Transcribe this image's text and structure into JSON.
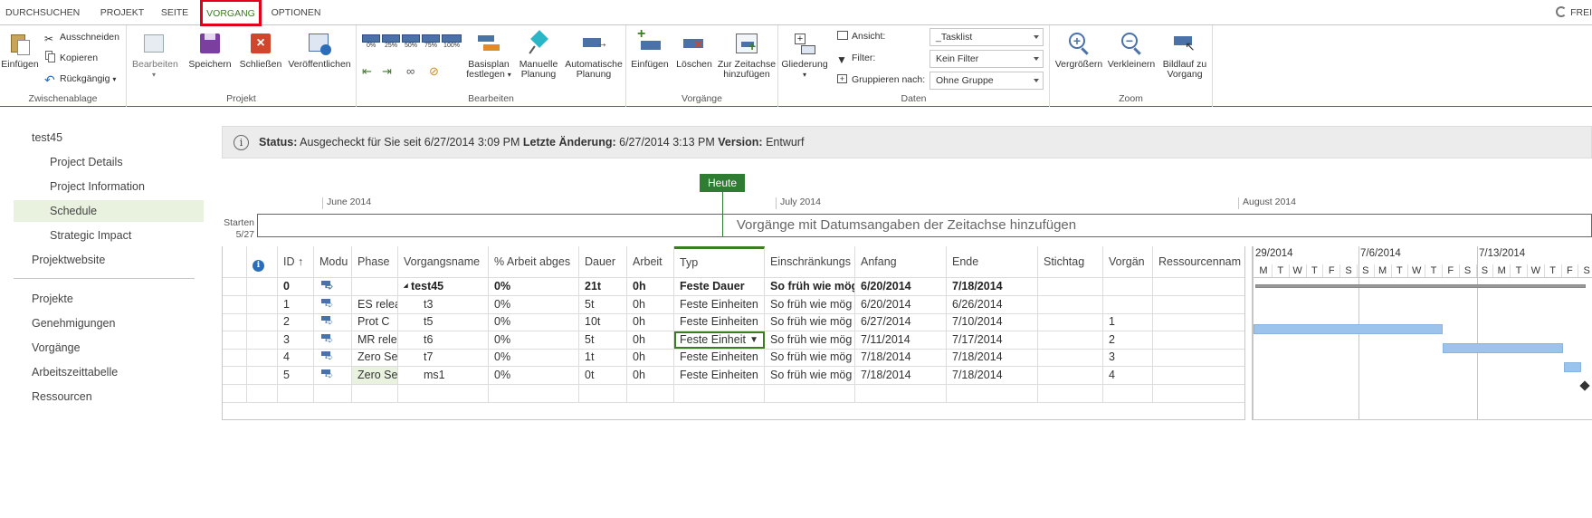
{
  "tabs": [
    "DURCHSUCHEN",
    "PROJEKT",
    "SEITE",
    "VORGANG",
    "OPTIONEN"
  ],
  "active_tab": "VORGANG",
  "share_label": "FREI",
  "ribbon": {
    "zwischenablage": {
      "label": "Zwischenablage",
      "einfuegen": "Einfügen",
      "ausschneiden": "Ausschneiden",
      "kopieren": "Kopieren",
      "rueckgaengig": "Rückgängig"
    },
    "projekt": {
      "label": "Projekt",
      "bearbeiten": "Bearbeiten",
      "speichern": "Speichern",
      "schliessen": "Schließen",
      "veroeffentlichen": "Veröffentlichen"
    },
    "bearbeiten": {
      "label": "Bearbeiten",
      "pct": [
        "0%",
        "25%",
        "50%",
        "75%",
        "100%"
      ],
      "basisplan_1": "Basisplan",
      "basisplan_2": "festlegen",
      "manuelle_1": "Manuelle",
      "manuelle_2": "Planung",
      "automatische_1": "Automatische",
      "automatische_2": "Planung"
    },
    "vorgaenge": {
      "label": "Vorgänge",
      "einfuegen": "Einfügen",
      "loeschen": "Löschen",
      "zeitachse_1": "Zur Zeitachse",
      "zeitachse_2": "hinzufügen"
    },
    "daten": {
      "label": "Daten",
      "gliederung": "Gliederung",
      "ansicht": "Ansicht:",
      "ansicht_value": "_Tasklist",
      "filter": "Filter:",
      "filter_value": "Kein Filter",
      "gruppieren": "Gruppieren nach:",
      "gruppieren_value": "Ohne Gruppe"
    },
    "zoom": {
      "label": "Zoom",
      "vergroessern": "Vergrößern",
      "verkleinern": "Verkleinern",
      "bildlauf_1": "Bildlauf zu",
      "bildlauf_2": "Vorgang"
    }
  },
  "nav": {
    "items": [
      "test45",
      "Project Details",
      "Project Information",
      "Schedule",
      "Strategic Impact",
      "Projektwebsite"
    ],
    "items2": [
      "Projekte",
      "Genehmigungen",
      "Vorgänge",
      "Arbeitszeittabelle",
      "Ressourcen"
    ],
    "selected": "Schedule"
  },
  "status": {
    "label_status": "Status:",
    "status_text": "Ausgecheckt für Sie seit 6/27/2014 3:09 PM",
    "label_last": "Letzte Änderung:",
    "last_text": "6/27/2014 3:13 PM",
    "label_version": "Version:",
    "version_text": "Entwurf"
  },
  "timeline": {
    "today_label": "Heute",
    "months": [
      "June 2014",
      "July 2014",
      "August 2014"
    ],
    "start_label_1": "Starten",
    "start_label_2": "5/27",
    "placeholder": "Vorgänge mit Datumsangaben der Zeitachse hinzufügen"
  },
  "grid": {
    "headers": [
      "ID ↑",
      "Modu",
      "Phase",
      "Vorgangsname",
      "% Arbeit abges",
      "Dauer",
      "Arbeit",
      "Typ",
      "Einschränkungs",
      "Anfang",
      "Ende",
      "Stichtag",
      "Vorgän",
      "Ressourcennam"
    ],
    "rows": [
      {
        "id": "0",
        "phase": "",
        "name": "test45",
        "pct": "0%",
        "dauer": "21t",
        "arbeit": "0h",
        "typ": "Feste Dauer",
        "einschr": "So früh wie mög",
        "anfang": "6/20/2014",
        "ende": "7/18/2014",
        "stichtag": "",
        "vorg": "",
        "res": ""
      },
      {
        "id": "1",
        "phase": "ES relea",
        "name": "t3",
        "pct": "0%",
        "dauer": "5t",
        "arbeit": "0h",
        "typ": "Feste Einheiten",
        "einschr": "So früh wie mög",
        "anfang": "6/20/2014",
        "ende": "6/26/2014",
        "stichtag": "",
        "vorg": "",
        "res": ""
      },
      {
        "id": "2",
        "phase": "Prot C",
        "name": "t5",
        "pct": "0%",
        "dauer": "10t",
        "arbeit": "0h",
        "typ": "Feste Einheiten",
        "einschr": "So früh wie mög",
        "anfang": "6/27/2014",
        "ende": "7/10/2014",
        "stichtag": "",
        "vorg": "1",
        "res": ""
      },
      {
        "id": "3",
        "phase": "MR relea",
        "name": "t6",
        "pct": "0%",
        "dauer": "5t",
        "arbeit": "0h",
        "typ": "Feste Einheit",
        "einschr": "So früh wie mög",
        "anfang": "7/11/2014",
        "ende": "7/17/2014",
        "stichtag": "",
        "vorg": "2",
        "res": ""
      },
      {
        "id": "4",
        "phase": "Zero Ser",
        "name": "t7",
        "pct": "0%",
        "dauer": "1t",
        "arbeit": "0h",
        "typ": "Feste Einheiten",
        "einschr": "So früh wie mög",
        "anfang": "7/18/2014",
        "ende": "7/18/2014",
        "stichtag": "",
        "vorg": "3",
        "res": ""
      },
      {
        "id": "5",
        "phase": "Zero Ser",
        "name": "ms1",
        "pct": "0%",
        "dauer": "0t",
        "arbeit": "0h",
        "typ": "Feste Einheiten",
        "einschr": "So früh wie mög",
        "anfang": "7/18/2014",
        "ende": "7/18/2014",
        "stichtag": "",
        "vorg": "4",
        "res": ""
      }
    ]
  },
  "gantt": {
    "weeks": [
      "29/2014",
      "7/6/2014",
      "7/13/2014"
    ],
    "days": [
      "M",
      "T",
      "W",
      "T",
      "F",
      "S",
      "S",
      "M",
      "T",
      "W",
      "T",
      "F",
      "S",
      "S",
      "M",
      "T",
      "W",
      "T",
      "F",
      "S"
    ]
  },
  "colors": {
    "accent": "#3b7d23",
    "tab_highlight": "#e2001a",
    "bar": "#9cc3eb",
    "today": "#2f7d32"
  }
}
